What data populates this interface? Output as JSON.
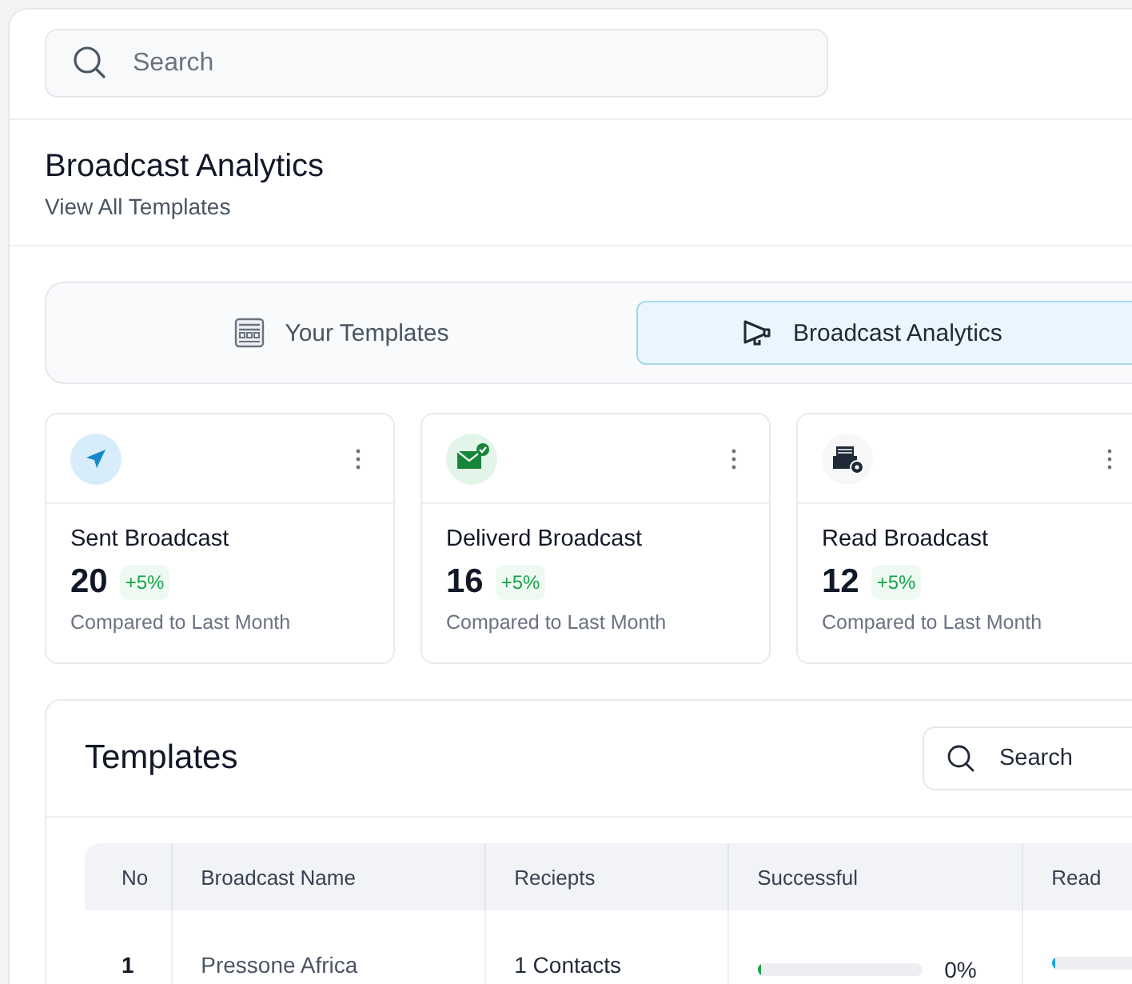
{
  "search": {
    "placeholder": "Search"
  },
  "header": {
    "title": "Broadcast Analytics",
    "subtitle": "View All Templates"
  },
  "tabs": [
    {
      "label": "Your Templates",
      "kind": "template",
      "selected": false
    },
    {
      "label": "Broadcast Analytics",
      "kind": "megaphone",
      "selected": true
    }
  ],
  "stats": [
    {
      "kind": "send",
      "label": "Sent Broadcast",
      "value": "20",
      "change": "+5%",
      "note": "Compared to Last Month"
    },
    {
      "kind": "delivered",
      "label": "Deliverd Broadcast",
      "value": "16",
      "change": "+5%",
      "note": "Compared to Last Month"
    },
    {
      "kind": "read",
      "label": "Read Broadcast",
      "value": "12",
      "change": "+5%",
      "note": "Compared to Last Month"
    }
  ],
  "templates": {
    "title": "Templates",
    "search_placeholder": "Search",
    "columns": [
      "No",
      "Broadcast Name",
      "Reciepts",
      "Successful",
      "Read"
    ],
    "rows": [
      {
        "no": "1",
        "name": "Pressone Africa",
        "recipients": "1 Contacts",
        "successful": {
          "level": 0.02,
          "reading": "0%"
        },
        "read": {
          "level": 0.02
        }
      }
    ]
  }
}
